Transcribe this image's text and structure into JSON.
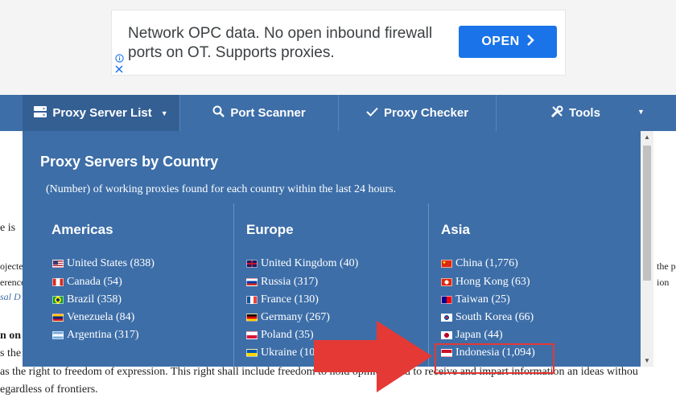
{
  "ad": {
    "text": "Network OPC data. No open inbound firewall ports on OT. Supports proxies.",
    "button_label": "OPEN",
    "button_color": "#1a73e8"
  },
  "nav": {
    "items": [
      {
        "label": "Proxy Server List",
        "icon": "server-icon"
      },
      {
        "label": "Port Scanner",
        "icon": "search-icon"
      },
      {
        "label": "Proxy Checker",
        "icon": "check-icon"
      },
      {
        "label": "Tools",
        "icon": "tools-icon"
      }
    ],
    "bg_color": "#3d6ea8"
  },
  "background_text": {
    "line1": "e is",
    "line2": "ojected",
    "line3": "erence",
    "line4": "sal D",
    "line5": "n on",
    "line6": "s the",
    "line7": "as the right to freedom of expression. This right shall include freedom to hold opinions and to receive and impart information an ideas withou",
    "line8": "egardless of frontiers.",
    "right1": "the p",
    "right2": "ion"
  },
  "dropdown": {
    "title": "Proxy Servers by Country",
    "subtitle": "(Number) of working proxies found for each country within the last 24 hours.",
    "columns": [
      {
        "region": "Americas",
        "countries": [
          {
            "name": "United States (838)",
            "flag": "us-flag"
          },
          {
            "name": "Canada (54)",
            "flag": "ca-flag"
          },
          {
            "name": "Brazil (358)",
            "flag": "br-flag"
          },
          {
            "name": "Venezuela (84)",
            "flag": "ve-flag"
          },
          {
            "name": "Argentina (317)",
            "flag": "ar-flag"
          }
        ]
      },
      {
        "region": "Europe",
        "countries": [
          {
            "name": "United Kingdom (40)",
            "flag": "gb-flag"
          },
          {
            "name": "Russia (317)",
            "flag": "ru-flag"
          },
          {
            "name": "France (130)",
            "flag": "fr-flag"
          },
          {
            "name": "Germany (267)",
            "flag": "de-flag"
          },
          {
            "name": "Poland (35)",
            "flag": "pl-flag"
          },
          {
            "name": "Ukraine (102)",
            "flag": "ua-flag"
          }
        ]
      },
      {
        "region": "Asia",
        "countries": [
          {
            "name": "China (1,776)",
            "flag": "cn-flag"
          },
          {
            "name": "Hong Kong (63)",
            "flag": "hk-flag"
          },
          {
            "name": "Taiwan (25)",
            "flag": "tw-flag"
          },
          {
            "name": "South Korea (66)",
            "flag": "kr-flag"
          },
          {
            "name": "Japan (44)",
            "flag": "jp-flag"
          },
          {
            "name": "Indonesia (1,094)",
            "flag": "id-flag"
          }
        ]
      }
    ]
  },
  "annotation": {
    "arrow_color": "#e53935",
    "highlight_target": "Indonesia (1,094)"
  }
}
